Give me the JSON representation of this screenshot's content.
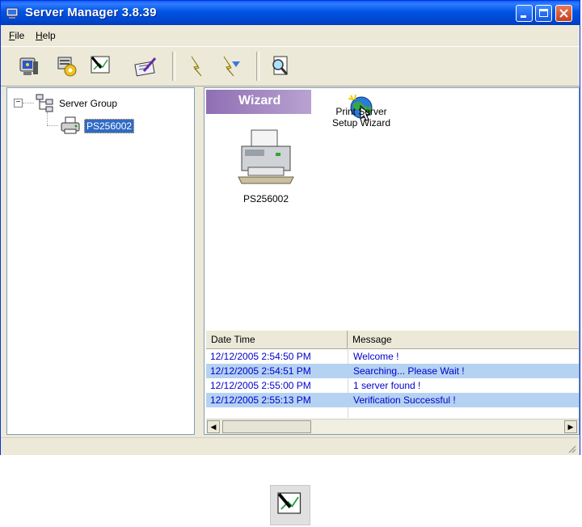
{
  "window": {
    "title": "Server Manager 3.8.39",
    "minimize_label": "",
    "maximize_label": "",
    "close_label": ""
  },
  "menu": {
    "file_first": "F",
    "file_rest": "ile",
    "help_first": "H",
    "help_rest": "elp"
  },
  "toolbar": {
    "icons": [
      "monitor-icon",
      "gear-settings-icon",
      "wand-chart-icon",
      "edit-notes-icon",
      "lightning-icon",
      "lightning-filter-icon",
      "search-doc-icon"
    ]
  },
  "tree": {
    "root_label": "Server Group",
    "child_label": "PS256002",
    "expander": "−"
  },
  "wizard": {
    "banner": "Wizard",
    "device_label": "PS256002",
    "wizard_item_line1": "Print Server",
    "wizard_item_line2": "Setup Wizard"
  },
  "log": {
    "columns": [
      "Date Time",
      "Message"
    ],
    "rows": [
      {
        "datetime": "12/12/2005 2:54:50 PM",
        "message": "Welcome !"
      },
      {
        "datetime": "12/12/2005 2:54:51 PM",
        "message": "Searching... Please Wait !"
      },
      {
        "datetime": "12/12/2005 2:55:00 PM",
        "message": "1 server found !"
      },
      {
        "datetime": "12/12/2005 2:55:13 PM",
        "message": "Verification Successful !"
      }
    ]
  },
  "colors": {
    "title_blue": "#0054e3",
    "selection_blue": "#316ac5",
    "log_text_blue": "#0000cc",
    "wizard_purple": "#9d82bf"
  }
}
